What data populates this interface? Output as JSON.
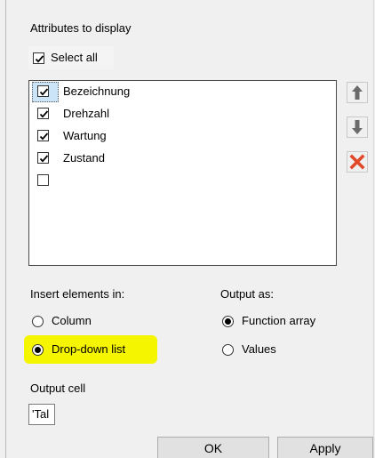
{
  "dialog": {
    "attributes_label": "Attributes to display",
    "select_all": {
      "label": "Select all",
      "checked": true
    },
    "attributes": [
      {
        "label": "Bezeichnung",
        "checked": true
      },
      {
        "label": "Drehzahl",
        "checked": true
      },
      {
        "label": "Wartung",
        "checked": true
      },
      {
        "label": "Zustand",
        "checked": true
      },
      {
        "label": "",
        "checked": false
      }
    ],
    "side_buttons": {
      "move_up_icon": "arrow-up-icon",
      "move_down_icon": "arrow-down-icon",
      "delete_icon": "red-x-icon"
    },
    "insert_elements": {
      "label": "Insert elements in:",
      "options": [
        {
          "label": "Column",
          "selected": false
        },
        {
          "label": "Drop-down list",
          "selected": true
        }
      ]
    },
    "output_as": {
      "label": "Output as:",
      "options": [
        {
          "label": "Function array",
          "selected": true
        },
        {
          "label": "Values",
          "selected": false
        }
      ]
    },
    "output_cell": {
      "label": "Output cell",
      "value": "'Tal"
    },
    "buttons": {
      "ok": "OK",
      "apply": "Apply"
    },
    "colors": {
      "highlight": "#f5f500",
      "delete": "#e0492a",
      "arrow": "#6b6b6b"
    }
  }
}
